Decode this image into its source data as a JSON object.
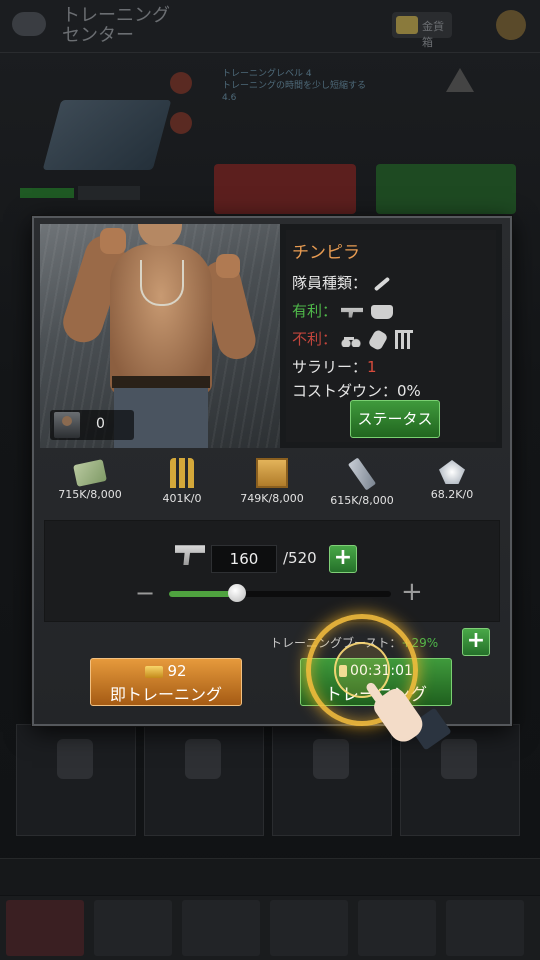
{
  "background": {
    "title": "トレーニング\nセンター",
    "currency_text": "金貨箱",
    "info_text": "トレーニングレベル 4\nトレーニングの時間を少し短縮する\n4.6"
  },
  "unit": {
    "name": "チンピラ",
    "type_label": "隊員種類：",
    "advantage_label": "有利：",
    "disadvantage_label": "不利：",
    "salary_label": "サラリー：",
    "salary_value": "1",
    "cost_down_label": "コストダウン：0%",
    "owned_count": "0",
    "status_button": "ステータス"
  },
  "resources": [
    {
      "icon": "cash-icon",
      "value": "715K/8,000"
    },
    {
      "icon": "ammo-icon",
      "value": "401K/0"
    },
    {
      "icon": "crate-icon",
      "value": "749K/8,000"
    },
    {
      "icon": "steel-icon",
      "value": "615K/8,000"
    },
    {
      "icon": "diamond-icon",
      "value": "68.2K/0"
    }
  ],
  "training": {
    "quantity": "160",
    "max": "/520",
    "slider_fraction": 0.3077
  },
  "boost": {
    "label": "トレーニングブースト：",
    "value": "+29%"
  },
  "actions": {
    "instant_cost": "92",
    "instant_label": "即トレーニング",
    "train_time": "00:31:01",
    "train_label": "トレーニング"
  },
  "colors": {
    "unit_name": "#e79b52",
    "advantage": "#4fb84a",
    "disadvantage": "#c2453c",
    "accent_green": "#3f9a3c",
    "accent_orange": "#e69a3c"
  }
}
